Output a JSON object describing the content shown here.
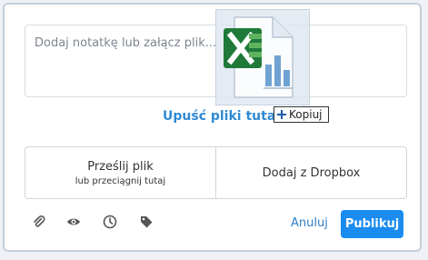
{
  "note": {
    "placeholder": "Dodaj notatkę lub załącz plik..."
  },
  "drop_zone": {
    "label": "Upuść pliki tutaj"
  },
  "drag": {
    "icon": "excel-file-icon",
    "copy_label": "Kopiuj"
  },
  "actions": {
    "upload_main": "Prześlij plik",
    "upload_sub": "lub przeciągnij tutaj",
    "dropbox": "Dodaj z Dropbox"
  },
  "toolbar": {
    "icons": [
      "paperclip-icon",
      "eye-icon",
      "clock-icon",
      "tag-icon"
    ],
    "cancel": "Anuluj",
    "publish": "Publikuj"
  },
  "colors": {
    "accent": "#1a8cf0",
    "link": "#2f7fc8",
    "border": "#c3cfda",
    "excel_green": "#1f7a3a"
  }
}
